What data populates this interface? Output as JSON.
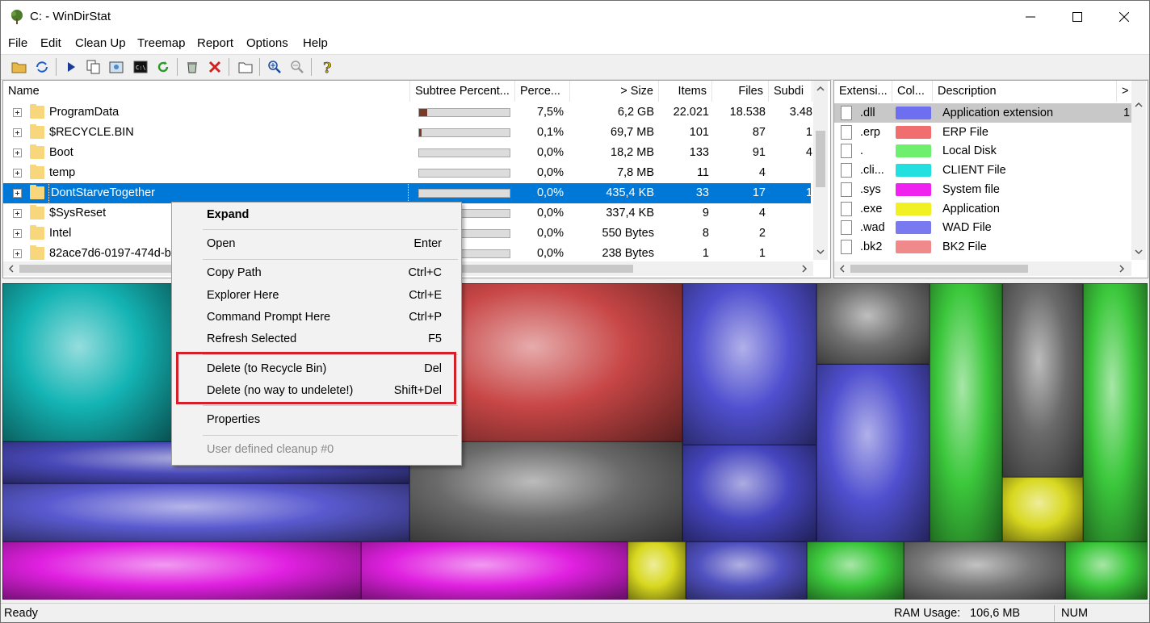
{
  "window": {
    "title": "C: - WinDirStat"
  },
  "menubar": [
    "File",
    "Edit",
    "Clean Up",
    "Treemap",
    "Report",
    "Options",
    "Help"
  ],
  "dirlist": {
    "columns": [
      "Name",
      "Subtree Percent...",
      "Perce...",
      "> Size",
      "Items",
      "Files",
      "Subdi"
    ],
    "rows": [
      {
        "name": "ProgramData",
        "pct": "7,5%",
        "size": "6,2 GB",
        "items": "22.021",
        "files": "18.538",
        "subdirs": "3.48",
        "fill": 0.075
      },
      {
        "name": "$RECYCLE.BIN",
        "pct": "0,1%",
        "size": "69,7 MB",
        "items": "101",
        "files": "87",
        "subdirs": "1",
        "fill": 0.001
      },
      {
        "name": "Boot",
        "pct": "0,0%",
        "size": "18,2 MB",
        "items": "133",
        "files": "91",
        "subdirs": "4",
        "fill": 0
      },
      {
        "name": "temp",
        "pct": "0,0%",
        "size": "7,8 MB",
        "items": "11",
        "files": "4",
        "subdirs": "",
        "fill": 0
      },
      {
        "name": "DontStarveTogether",
        "pct": "0,0%",
        "size": "435,4 KB",
        "items": "33",
        "files": "17",
        "subdirs": "1",
        "fill": 0
      },
      {
        "name": "$SysReset",
        "pct": "0,0%",
        "size": "337,4 KB",
        "items": "9",
        "files": "4",
        "subdirs": "",
        "fill": 0
      },
      {
        "name": "Intel",
        "pct": "0,0%",
        "size": "550 Bytes",
        "items": "8",
        "files": "2",
        "subdirs": "",
        "fill": 0
      },
      {
        "name": "82ace7d6-0197-474d-bf",
        "pct": "0,0%",
        "size": "238 Bytes",
        "items": "1",
        "files": "1",
        "subdirs": "",
        "fill": 0
      }
    ]
  },
  "extlist": {
    "columns": [
      "Extensi...",
      "Col...",
      "Description",
      ">"
    ],
    "rows": [
      {
        "ext": ".dll",
        "desc": "Application extension",
        "color": "#6e6ef0",
        "trail": "1"
      },
      {
        "ext": ".erp",
        "desc": "ERP File",
        "color": "#f06e6e",
        "trail": ""
      },
      {
        "ext": ".",
        "desc": "Local Disk",
        "color": "#6ef06e",
        "trail": ""
      },
      {
        "ext": ".cli...",
        "desc": "CLIENT File",
        "color": "#22e0e0",
        "trail": ""
      },
      {
        "ext": ".sys",
        "desc": "System file",
        "color": "#f022f0",
        "trail": ""
      },
      {
        "ext": ".exe",
        "desc": "Application",
        "color": "#f0f022",
        "trail": ""
      },
      {
        "ext": ".wad",
        "desc": "WAD File",
        "color": "#7a7af0",
        "trail": ""
      },
      {
        "ext": ".bk2",
        "desc": "BK2 File",
        "color": "#f08a8a",
        "trail": ""
      }
    ]
  },
  "context_menu": {
    "items": [
      {
        "label": "Expand",
        "shortcut": ""
      },
      {
        "label": "Open",
        "shortcut": "Enter"
      },
      {
        "label": "Copy Path",
        "shortcut": "Ctrl+C"
      },
      {
        "label": "Explorer Here",
        "shortcut": "Ctrl+E"
      },
      {
        "label": "Command Prompt Here",
        "shortcut": "Ctrl+P"
      },
      {
        "label": "Refresh Selected",
        "shortcut": "F5"
      },
      {
        "label": "Delete (to Recycle Bin)",
        "shortcut": "Del"
      },
      {
        "label": "Delete (no way to undelete!)",
        "shortcut": "Shift+Del"
      },
      {
        "label": "Properties",
        "shortcut": ""
      },
      {
        "label": "User defined cleanup #0",
        "shortcut": ""
      }
    ],
    "highlight_color": "#d4202a"
  },
  "statusbar": {
    "left": "Ready",
    "ram_label": "RAM Usage:",
    "ram_value": "106,6 MB",
    "num": "NUM"
  },
  "colors": {
    "selection": "#0078d7",
    "treemap_teal": "#14b4b4",
    "treemap_red": "#c84646",
    "treemap_blue": "#5050d0",
    "treemap_green": "#3cc83c",
    "treemap_magenta": "#e020e0",
    "treemap_yellow": "#d8d820"
  }
}
